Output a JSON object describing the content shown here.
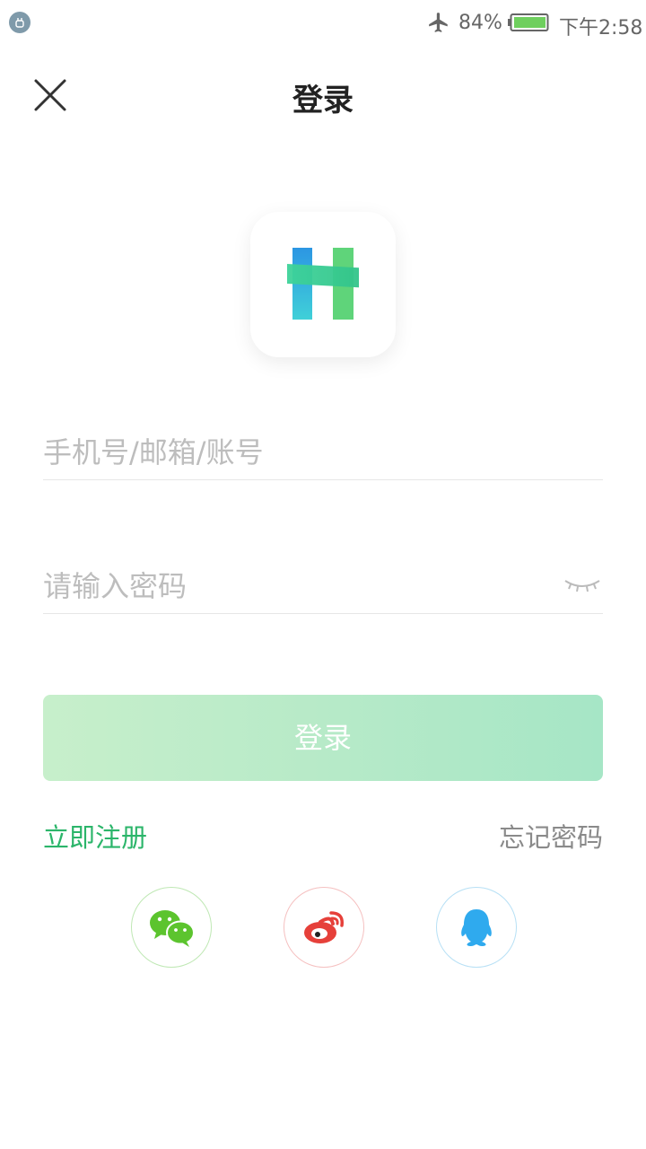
{
  "status_bar": {
    "battery_percent": "84%",
    "time": "下午2:58",
    "icons": [
      "usb-debug-icon",
      "airplane-mode-icon",
      "battery-icon"
    ],
    "battery_level": 0.84
  },
  "header": {
    "title": "登录",
    "close_icon": "close-icon"
  },
  "logo": {
    "icon": "app-logo-h",
    "colors": [
      "#3aa0e8",
      "#3ecf9a",
      "#5fd47a"
    ]
  },
  "form": {
    "account_placeholder": "手机号/邮箱/账号",
    "account_value": "",
    "password_placeholder": "请输入密码",
    "password_value": "",
    "eye_icon": "eye-closed-icon"
  },
  "actions": {
    "login_label": "登录",
    "register_label": "立即注册",
    "forgot_label": "忘记密码"
  },
  "social_login": [
    {
      "name": "wechat",
      "icon": "wechat-icon",
      "color": "#5cc42e"
    },
    {
      "name": "weibo",
      "icon": "weibo-icon",
      "color": "#e6403a"
    },
    {
      "name": "qq",
      "icon": "qq-icon",
      "color": "#2faaee"
    }
  ],
  "colors": {
    "accent_green": "#2bb56a",
    "button_gradient_start": "#c7efcb",
    "button_gradient_end": "#a6e6c6"
  }
}
